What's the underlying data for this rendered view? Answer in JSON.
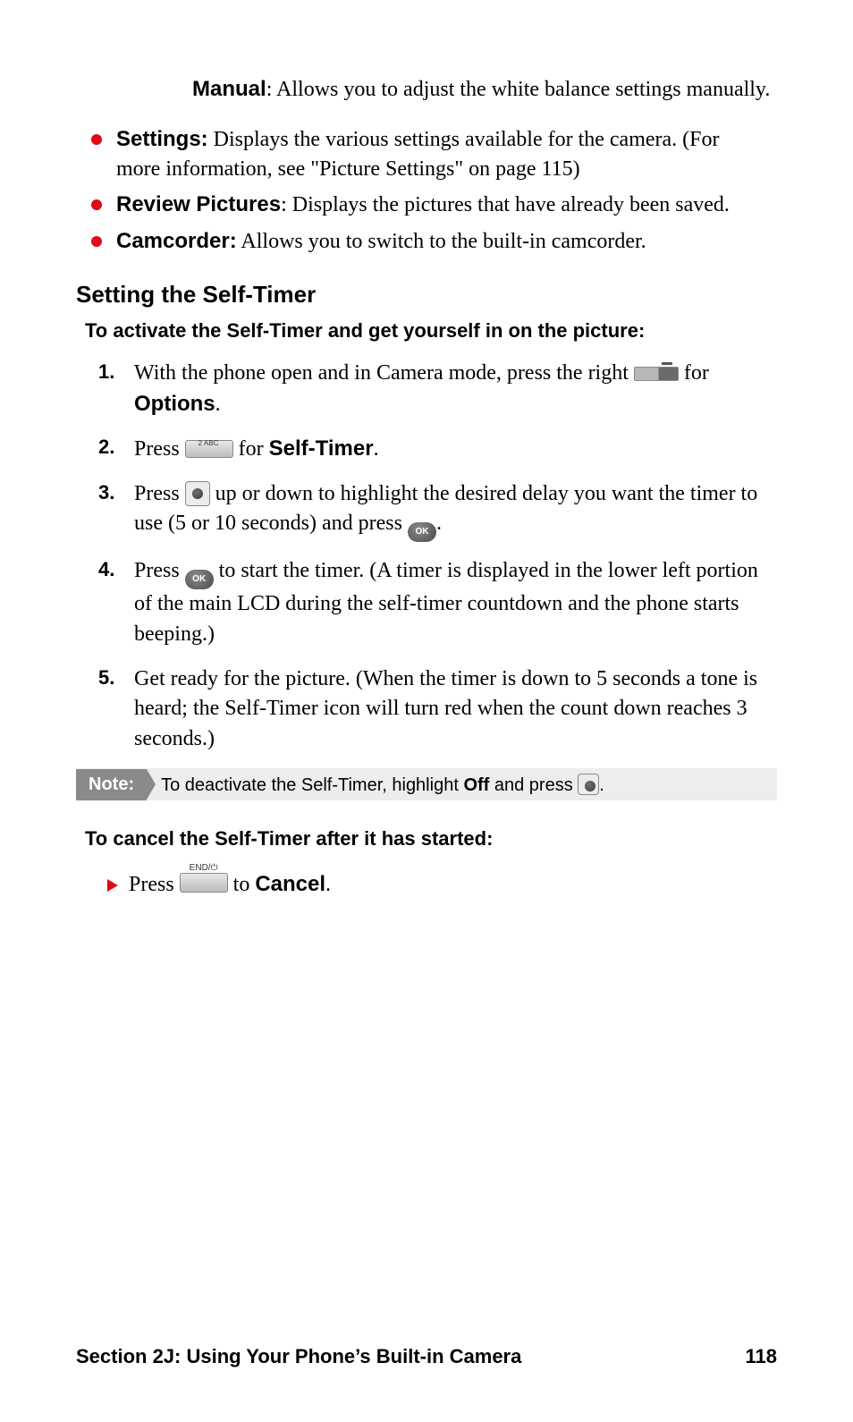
{
  "manual": {
    "term": "Manual",
    "desc": ": Allows you to adjust the white balance settings manually."
  },
  "bullets": [
    {
      "term": "Settings:",
      "desc": " Displays the various settings available for the camera. (For more information, see \"Picture Settings\" on page 115)"
    },
    {
      "term": "Review Pictures",
      "desc": ": Displays the pictures that have already been saved."
    },
    {
      "term": "Camcorder:",
      "desc": " Allows you to switch to the built-in camcorder."
    }
  ],
  "heading": "Setting the Self-Timer",
  "intro": "To activate the Self-Timer and get yourself in on the picture:",
  "steps": {
    "s1": {
      "a": "With the phone open and in Camera mode, press the right ",
      "b": " for ",
      "opt": "Options",
      "dot": "."
    },
    "s2": {
      "a": "Press ",
      "key_label": "2 ABC",
      "b": " for ",
      "opt": "Self-Timer",
      "dot": "."
    },
    "s3": {
      "a": "Press ",
      "b": " up or down to highlight the desired delay you want the timer to use (5 or 10 seconds) and press ",
      "ok": "OK",
      "dot": "."
    },
    "s4": {
      "a": "Press ",
      "ok": "OK",
      "b": " to start the timer. (A timer is displayed in the lower left portion of the main LCD during the self-timer countdown and the phone starts beeping.)"
    },
    "s5": {
      "a": "Get ready for the picture. (When the timer is down to 5 seconds a tone is heard; the Self-Timer icon will turn red when the count down reaches 3 seconds.)"
    }
  },
  "note": {
    "label": "Note:",
    "a": "To deactivate the Self-Timer, highlight ",
    "off": "Off",
    "b": " and press ",
    "dot": "."
  },
  "cancel_intro": "To cancel the Self-Timer after it has started:",
  "cancel_step": {
    "a": "Press ",
    "b": " to ",
    "opt": "Cancel",
    "dot": "."
  },
  "footer": {
    "section": "Section 2J: Using Your Phone’s Built-in Camera",
    "page": "118"
  }
}
